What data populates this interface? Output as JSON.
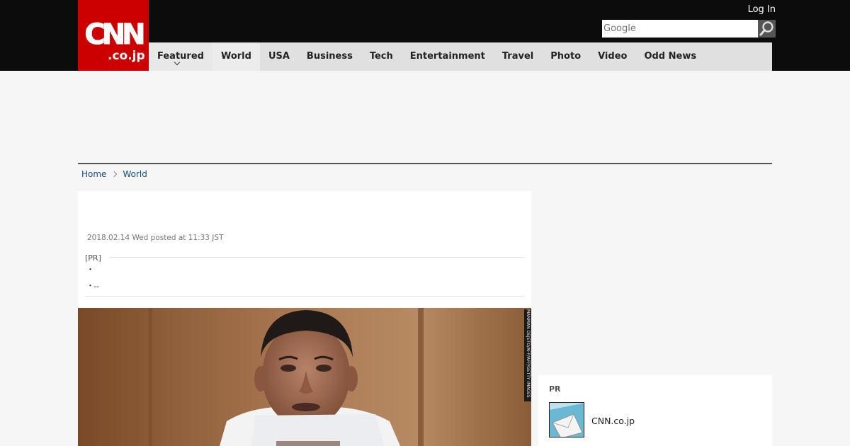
{
  "header": {
    "logo_main": "CNN",
    "logo_sub": ".co.jp",
    "login_label": "Log In",
    "search_placeholder": "Google"
  },
  "nav": {
    "items": [
      {
        "label": "Featured"
      },
      {
        "label": "World"
      },
      {
        "label": "USA"
      },
      {
        "label": "Business"
      },
      {
        "label": "Tech"
      },
      {
        "label": "Entertainment"
      },
      {
        "label": "Travel"
      },
      {
        "label": "Photo"
      },
      {
        "label": "Video"
      },
      {
        "label": "Odd News"
      }
    ]
  },
  "breadcrumb": {
    "home": "Home",
    "section": "World"
  },
  "article": {
    "posted": "2018.02.14 Wed posted at 11:33 JST",
    "pr_label": "[PR]",
    "pr_bullet": "・",
    "pr_link": "--",
    "photo_credit": "MANMAN DEJETO/AFP/AFP/GETTY IMAGES"
  },
  "sidebar": {
    "pr_title": "PR",
    "item_text": "CNN.co.jp"
  },
  "colors": {
    "brand_red": "#cc0000",
    "header_black": "#0c0c0c",
    "nav_gray": "#e0e0e0",
    "link_blue": "#1a4c80"
  }
}
